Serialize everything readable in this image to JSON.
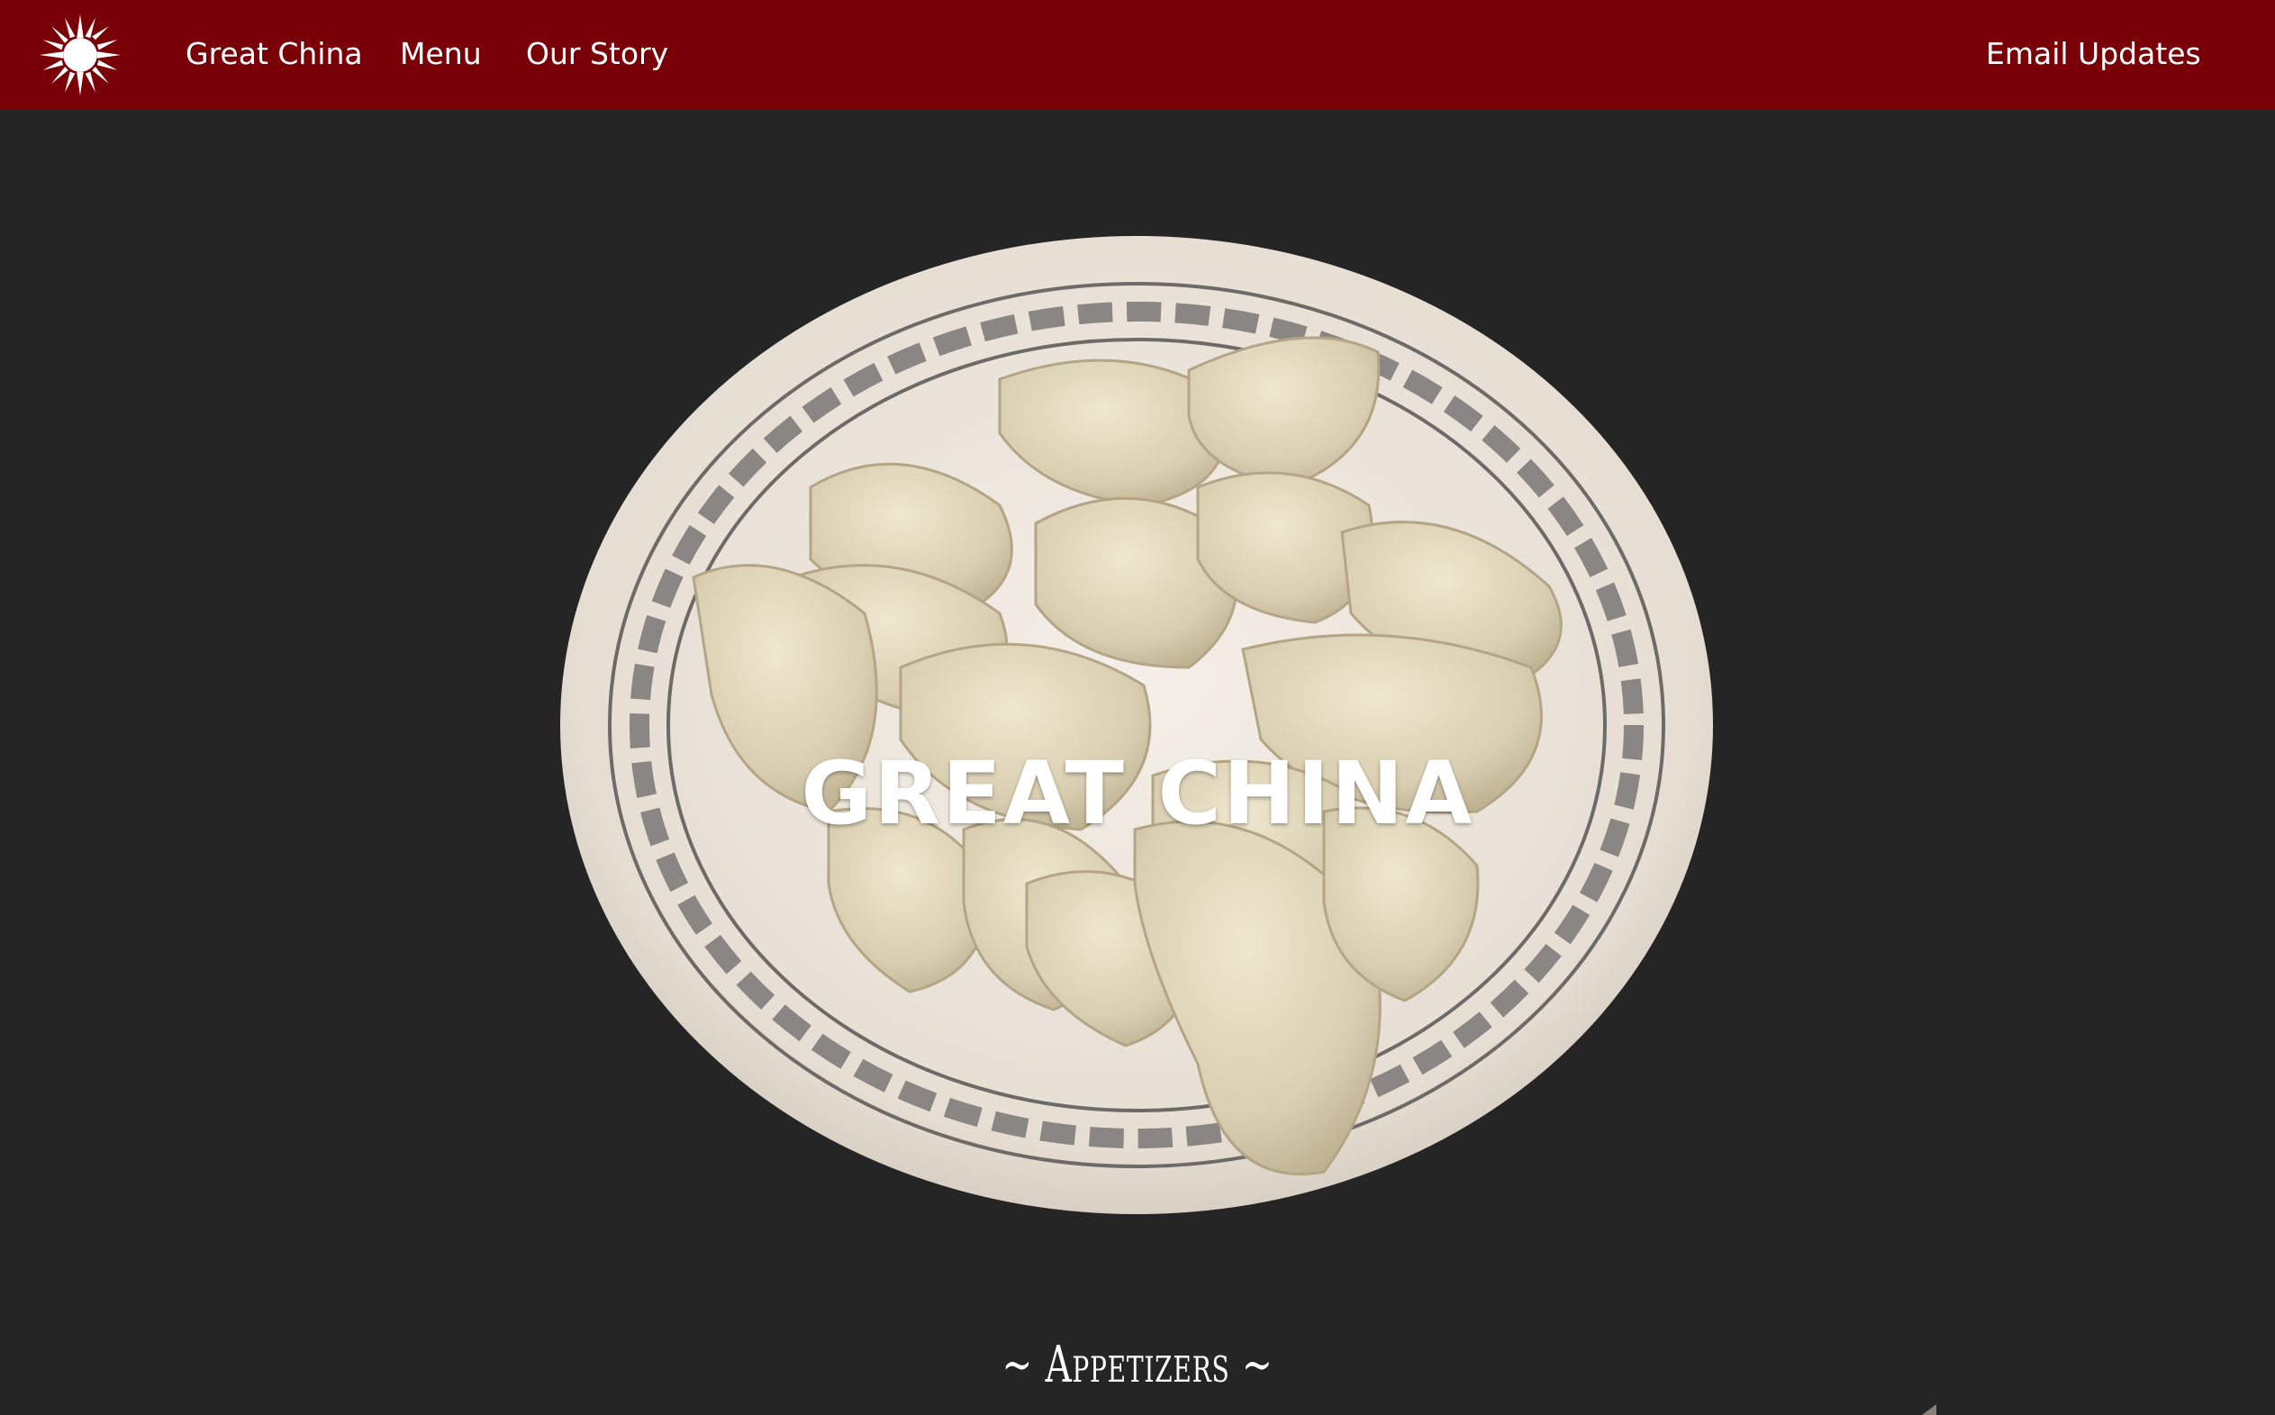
{
  "navbar": {
    "logo_icon": "sun-icon",
    "brand_label": "Great China",
    "menu_label": "Menu",
    "story_label": "Our Story",
    "email_label": "Email Updates",
    "background": "#7a0008"
  },
  "hero": {
    "title": "GREAT CHINA",
    "image_subject": "plate-of-dumplings"
  },
  "sections": {
    "appetizers_heading": "~ Appetizers ~"
  },
  "colors": {
    "page_background": "#252525",
    "text": "#ffffff"
  }
}
